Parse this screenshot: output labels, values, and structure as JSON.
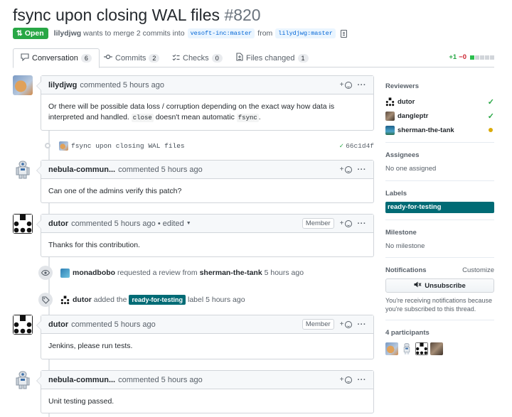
{
  "pr": {
    "title": "fsync upon closing WAL files",
    "number": "#820",
    "state": "Open",
    "author": "lilydjwg",
    "merge_text": "wants to merge 2 commits into",
    "base_branch": "vesoft-inc:master",
    "from_text": "from",
    "head_branch": "lilydjwg:master"
  },
  "tabs": [
    {
      "label": "Conversation",
      "count": "6",
      "icon": "comment-icon"
    },
    {
      "label": "Commits",
      "count": "2",
      "icon": "commit-icon"
    },
    {
      "label": "Checks",
      "count": "0",
      "icon": "checks-icon"
    },
    {
      "label": "Files changed",
      "count": "1",
      "icon": "file-diff-icon"
    }
  ],
  "diffstat": {
    "additions": "+1",
    "deletions": "−0"
  },
  "timeline": {
    "c1": {
      "author": "lilydjwg",
      "action": "commented",
      "time": "5 hours ago",
      "body_1": "Or there will be possible data loss / corruption depending on the exact way how data is interpreted and handled.",
      "code_1": "close",
      "body_2": "doesn't mean automatic",
      "code_2": "fsync",
      "body_3": "."
    },
    "commit": {
      "message": "fsync upon closing WAL files",
      "sha": "66c1d4f"
    },
    "c2": {
      "author": "nebula-commun...",
      "action": "commented",
      "time": "5 hours ago",
      "body": "Can one of the admins verify this patch?"
    },
    "c3": {
      "author": "dutor",
      "action": "commented",
      "time": "5 hours ago",
      "edited": "• edited",
      "badge": "Member",
      "body": "Thanks for this contribution."
    },
    "ev1": {
      "actor": "monadbobo",
      "text": "requested a review from",
      "target": "sherman-the-tank",
      "time": "5 hours ago"
    },
    "ev2": {
      "actor": "dutor",
      "text_1": "added the",
      "label": "ready-for-testing",
      "text_2": "label",
      "time": "5 hours ago"
    },
    "c4": {
      "author": "dutor",
      "action": "commented",
      "time": "5 hours ago",
      "badge": "Member",
      "body": "Jenkins, please run tests."
    },
    "c5": {
      "author": "nebula-commun...",
      "action": "commented",
      "time": "5 hours ago",
      "body": "Unit testing passed."
    }
  },
  "sidebar": {
    "reviewers_title": "Reviewers",
    "reviewers": [
      {
        "name": "dutor",
        "status": "approved"
      },
      {
        "name": "dangleptr",
        "status": "approved"
      },
      {
        "name": "sherman-the-tank",
        "status": "pending"
      }
    ],
    "assignees_title": "Assignees",
    "assignees_text": "No one assigned",
    "labels_title": "Labels",
    "label": "ready-for-testing",
    "label_color": "#006b75",
    "milestone_title": "Milestone",
    "milestone_text": "No milestone",
    "notifications_title": "Notifications",
    "customize": "Customize",
    "unsubscribe": "Unsubscribe",
    "notif_text": "You're receiving notifications because you're subscribed to this thread.",
    "participants_title": "4 participants"
  }
}
